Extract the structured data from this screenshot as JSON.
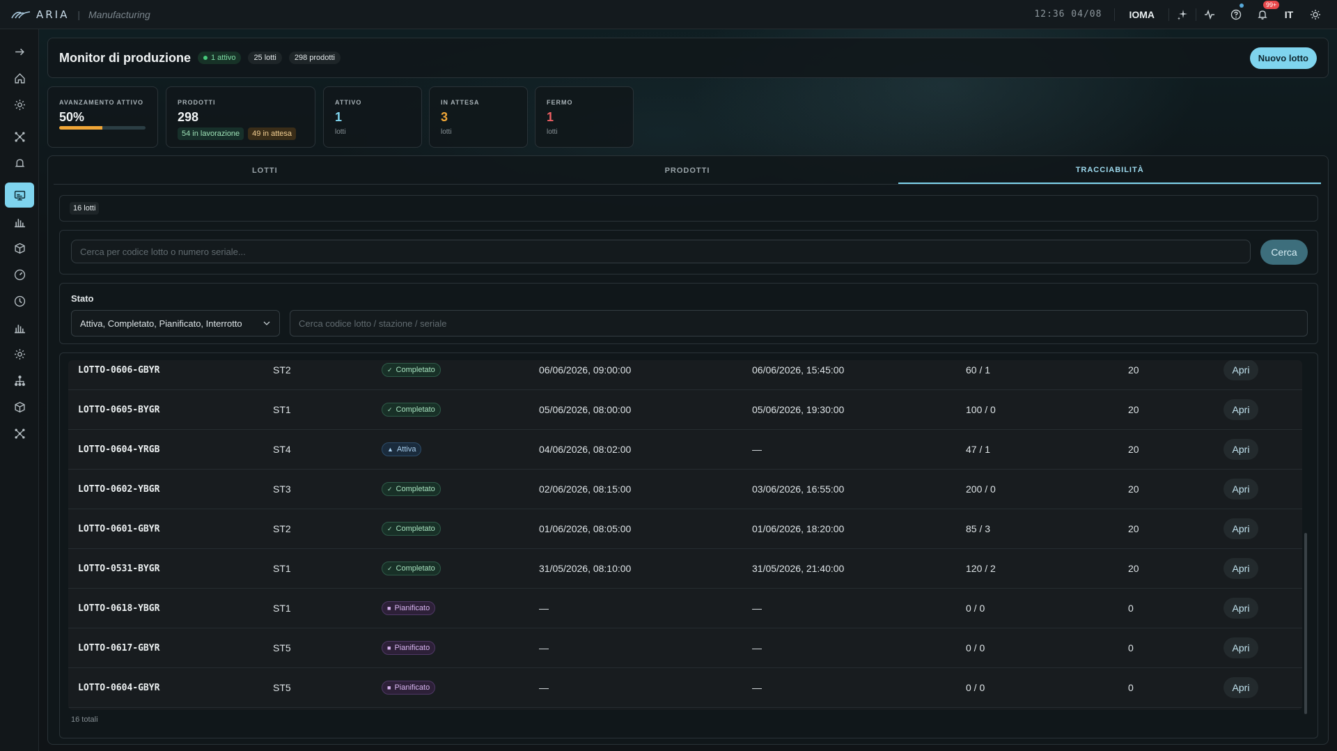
{
  "topbar": {
    "brand": "ARIA",
    "brand_sep": "|",
    "module": "Manufacturing",
    "clock": "12:36 04/08",
    "workspace": "IOMA",
    "notifications_badge": "99+",
    "language": "IT"
  },
  "header": {
    "title": "Monitor di produzione",
    "active_pill": "1 attivo",
    "lots_pill": "25 lotti",
    "products_pill": "298 prodotti",
    "new_lot_button": "Nuovo lotto"
  },
  "kpis": {
    "progress": {
      "label": "AVANZAMENTO ATTIVO",
      "value": "50%",
      "fraction": 0.5
    },
    "products": {
      "label": "PRODOTTI",
      "value": "298",
      "in_progress": "54 in lavorazione",
      "waiting": "49 in attesa"
    },
    "active": {
      "label": "ATTIVO",
      "value": "1",
      "unit": "lotti"
    },
    "waiting": {
      "label": "IN ATTESA",
      "value": "3",
      "unit": "lotti"
    },
    "stopped": {
      "label": "FERMO",
      "value": "1",
      "unit": "lotti"
    }
  },
  "tabs": [
    "LOTTI",
    "PRODOTTI",
    "TRACCIABILITÀ"
  ],
  "count_pill": "16 lotti",
  "search": {
    "placeholder": "Cerca per codice lotto o numero seriale...",
    "button": "Cerca"
  },
  "filter": {
    "label": "Stato",
    "selected": "Attiva, Completato, Pianificato, Interrotto",
    "input_placeholder": "Cerca codice lotto / stazione / seriale"
  },
  "rows": [
    {
      "code": "LOTTO-0606-GBYR",
      "station": "ST2",
      "status": "Completato",
      "start": "06/06/2026, 09:00:00",
      "end": "06/06/2026, 15:45:00",
      "qty": "60 / 1",
      "n": "20",
      "action": "Apri"
    },
    {
      "code": "LOTTO-0605-BYGR",
      "station": "ST1",
      "status": "Completato",
      "start": "05/06/2026, 08:00:00",
      "end": "05/06/2026, 19:30:00",
      "qty": "100 / 0",
      "n": "20",
      "action": "Apri"
    },
    {
      "code": "LOTTO-0604-YRGB",
      "station": "ST4",
      "status": "Attiva",
      "start": "04/06/2026, 08:02:00",
      "end": "—",
      "qty": "47 / 1",
      "n": "20",
      "action": "Apri"
    },
    {
      "code": "LOTTO-0602-YBGR",
      "station": "ST3",
      "status": "Completato",
      "start": "02/06/2026, 08:15:00",
      "end": "03/06/2026, 16:55:00",
      "qty": "200 / 0",
      "n": "20",
      "action": "Apri"
    },
    {
      "code": "LOTTO-0601-GBYR",
      "station": "ST2",
      "status": "Completato",
      "start": "01/06/2026, 08:05:00",
      "end": "01/06/2026, 18:20:00",
      "qty": "85 / 3",
      "n": "20",
      "action": "Apri"
    },
    {
      "code": "LOTTO-0531-BYGR",
      "station": "ST1",
      "status": "Completato",
      "start": "31/05/2026, 08:10:00",
      "end": "31/05/2026, 21:40:00",
      "qty": "120 / 2",
      "n": "20",
      "action": "Apri"
    },
    {
      "code": "LOTTO-0618-YBGR",
      "station": "ST1",
      "status": "Pianificato",
      "start": "—",
      "end": "—",
      "qty": "0 / 0",
      "n": "0",
      "action": "Apri"
    },
    {
      "code": "LOTTO-0617-GBYR",
      "station": "ST5",
      "status": "Pianificato",
      "start": "—",
      "end": "—",
      "qty": "0 / 0",
      "n": "0",
      "action": "Apri"
    },
    {
      "code": "LOTTO-0604-GBYR",
      "station": "ST5",
      "status": "Pianificato",
      "start": "—",
      "end": "—",
      "qty": "0 / 0",
      "n": "0",
      "action": "Apri"
    }
  ],
  "total_text": "16 totali",
  "colors": {
    "accent": "#7fd4ee",
    "progress": "#f0a637",
    "active_value": "#7fd4ee",
    "waiting_value": "#f0a637",
    "stopped_value": "#e8484b"
  }
}
